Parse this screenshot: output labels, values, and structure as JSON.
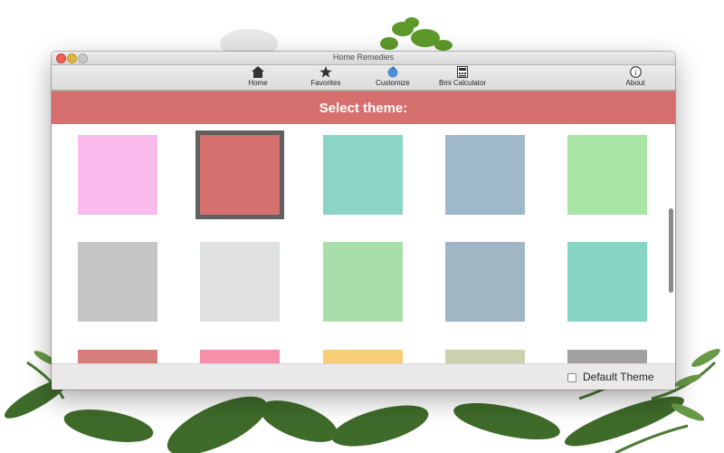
{
  "window": {
    "title": "Home Remedies"
  },
  "toolbar": {
    "items": [
      {
        "label": "Home",
        "icon": "home-icon"
      },
      {
        "label": "Favorites",
        "icon": "star-icon"
      },
      {
        "label": "Customize",
        "icon": "paint-drop-icon"
      },
      {
        "label": "Bmi Calculator",
        "icon": "calculator-icon"
      },
      {
        "label": "About",
        "icon": "info-icon"
      }
    ]
  },
  "header": {
    "title": "Select theme:",
    "color": "#d5706f"
  },
  "themes": [
    {
      "color": "#f9bbec"
    },
    {
      "color": "#d5706f",
      "selected": true
    },
    {
      "color": "#8ad5c6"
    },
    {
      "color": "#a0b9c9"
    },
    {
      "color": "#a8e4a3"
    },
    {
      "color": "#c4c6c6"
    },
    {
      "color": "#dfe0e0"
    },
    {
      "color": "#a8dea9"
    },
    {
      "color": "#a1b6c4"
    },
    {
      "color": "#86d4c4"
    },
    {
      "color": "#d77d7b"
    },
    {
      "color": "#f78fab"
    },
    {
      "color": "#f7ce75"
    },
    {
      "color": "#cdd0ae"
    },
    {
      "color": "#a0a0a0"
    }
  ],
  "footer": {
    "default_theme_label": "Default Theme",
    "default_theme_checked": false
  }
}
